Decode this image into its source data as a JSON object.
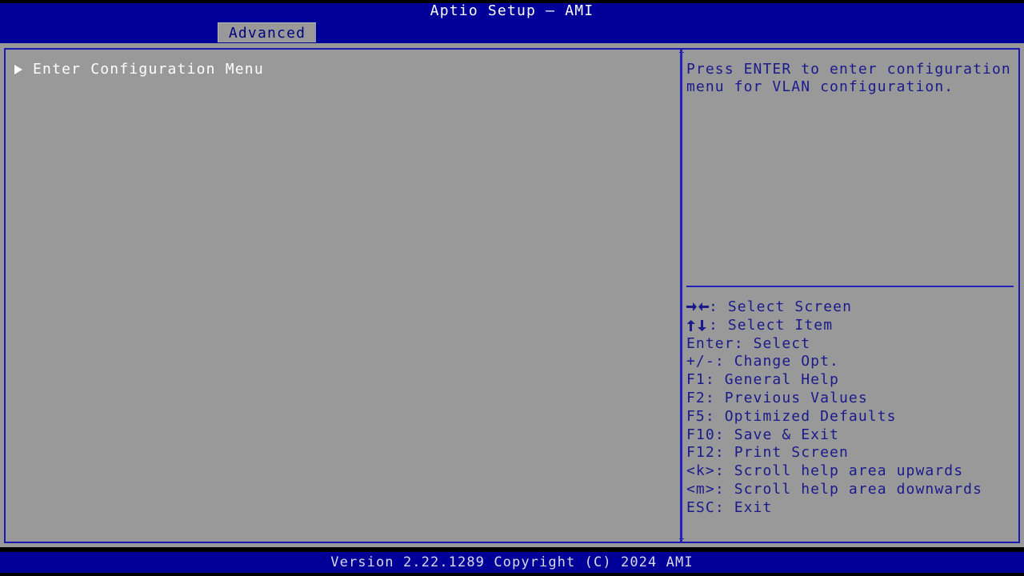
{
  "window": {
    "title": "Aptio Setup – AMI"
  },
  "colors": {
    "title_bar_blue": "#000099",
    "panel_gray": "#999999",
    "border_blue": "#2222bb",
    "help_text_blue": "#1a1a8c",
    "item_text_white": "#ffffff",
    "tab_text_blue": "#000080",
    "footer_text": "#d8d8e8",
    "outer_black": "#000000"
  },
  "tabs": [
    {
      "label": "Advanced",
      "selected": true
    }
  ],
  "main": {
    "items": [
      {
        "label": "Enter Configuration Menu",
        "icon": "submenu-arrow-icon",
        "has_submenu": true,
        "selected": true
      }
    ]
  },
  "help": {
    "text": "Press ENTER to enter configuration menu for VLAN configuration.",
    "key_legend": [
      {
        "keys": "→←",
        "glyph": "left-right-arrow-icon",
        "sep": ": ",
        "action": "Select Screen"
      },
      {
        "keys": "↑↓",
        "glyph": "up-down-arrow-icon",
        "sep": ": ",
        "action": "Select Item"
      },
      {
        "keys": "Enter",
        "glyph": null,
        "sep": ": ",
        "action": "Select"
      },
      {
        "keys": "+/-",
        "glyph": null,
        "sep": ": ",
        "action": "Change Opt."
      },
      {
        "keys": "F1",
        "glyph": null,
        "sep": ": ",
        "action": "General Help"
      },
      {
        "keys": "F2",
        "glyph": null,
        "sep": ": ",
        "action": "Previous Values"
      },
      {
        "keys": "F5",
        "glyph": null,
        "sep": ": ",
        "action": "Optimized Defaults"
      },
      {
        "keys": "F10",
        "glyph": null,
        "sep": ": ",
        "action": "Save & Exit"
      },
      {
        "keys": "F12",
        "glyph": null,
        "sep": ": ",
        "action": "Print Screen"
      },
      {
        "keys": "<k>",
        "glyph": null,
        "sep": ": ",
        "action": "Scroll help area upwards"
      },
      {
        "keys": "<m>",
        "glyph": null,
        "sep": ": ",
        "action": "Scroll help area downwards"
      },
      {
        "keys": "ESC",
        "glyph": null,
        "sep": ": ",
        "action": "Exit"
      }
    ]
  },
  "footer": {
    "version_text": "Version 2.22.1289 Copyright (C) 2024 AMI"
  }
}
